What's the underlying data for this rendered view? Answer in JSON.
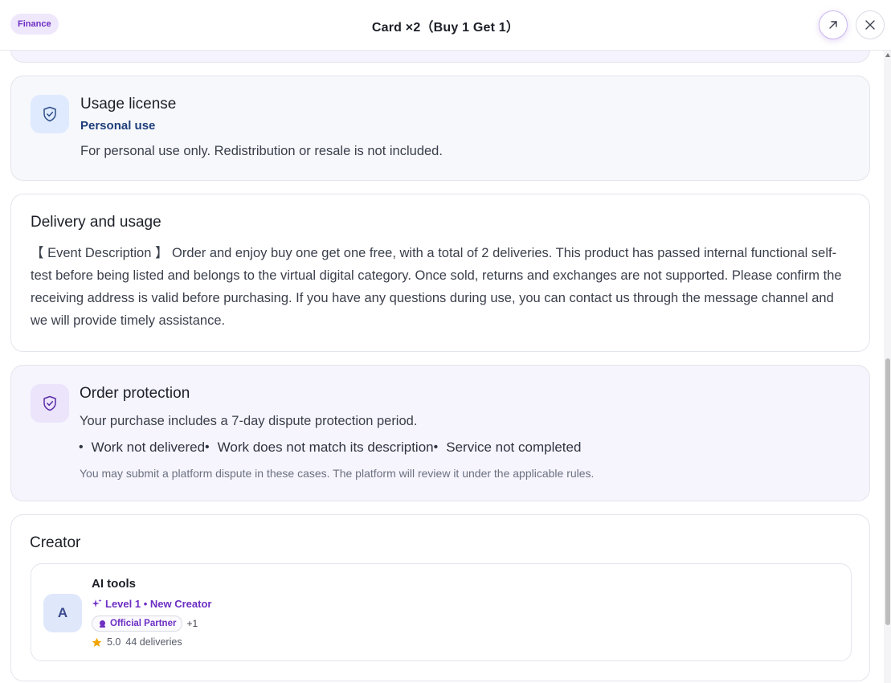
{
  "header": {
    "category": "Finance",
    "title": "Card ×2（Buy 1 Get 1）"
  },
  "license": {
    "title": "Usage license",
    "type": "Personal use",
    "note": "For personal use only. Redistribution or resale is not included."
  },
  "delivery": {
    "title": "Delivery and usage",
    "text": "【 Event Description 】 Order and enjoy buy one get one free, with a total of 2 deliveries. This product has passed internal functional self-test before being listed and belongs to the virtual digital category. Once sold, returns and exchanges are not supported. Please confirm the receiving address is valid before purchasing. If you have any questions during use, you can contact us through the message channel and we will provide timely assistance."
  },
  "protection": {
    "title": "Order protection",
    "period": "Your purchase includes a 7-day dispute protection period.",
    "cases": [
      "Work not delivered",
      "Work does not match its description",
      "Service not completed"
    ],
    "footnote": "You may submit a platform dispute in these cases. The platform will review it under the applicable rules."
  },
  "creator": {
    "section_title": "Creator",
    "avatar_letter": "A",
    "name": "AI tools",
    "level": "Level 1 • New Creator",
    "badge": "Official Partner",
    "extra_badges": "+1",
    "rating": "5.0",
    "deliveries": "44 deliveries"
  },
  "colors": {
    "accent": "#6d2fc3",
    "navy": "#1f3f7a",
    "star": "#f0a400"
  },
  "icons": {
    "open": "arrow-up-right-icon",
    "close": "close-icon",
    "license": "shield-check-icon",
    "protection": "shield-check-icon",
    "level": "sparkle-icon",
    "partner": "partner-icon",
    "rating": "star-icon"
  }
}
